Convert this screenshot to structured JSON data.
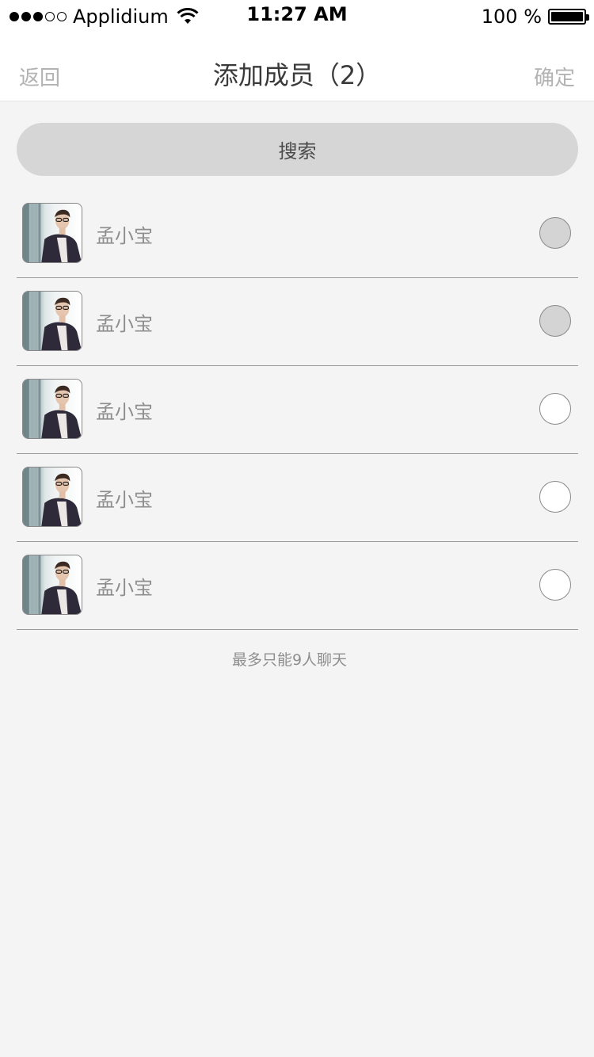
{
  "status_bar": {
    "carrier": "Applidium",
    "time": "11:27 AM",
    "battery": "100 %",
    "signal_strength": 3,
    "signal_max": 5
  },
  "nav": {
    "back_label": "返回",
    "title": "添加成员（2）",
    "confirm_label": "确定"
  },
  "search": {
    "label": "搜索"
  },
  "members": [
    {
      "name": "孟小宝",
      "selected": true
    },
    {
      "name": "孟小宝",
      "selected": true
    },
    {
      "name": "孟小宝",
      "selected": false
    },
    {
      "name": "孟小宝",
      "selected": false
    },
    {
      "name": "孟小宝",
      "selected": false
    }
  ],
  "footer_note": "最多只能9人聊天",
  "colors": {
    "background": "#f4f4f4",
    "search_bg": "#d6d6d6",
    "selected_radio": "#d4d4d4",
    "muted_text": "#8e8e8e"
  }
}
